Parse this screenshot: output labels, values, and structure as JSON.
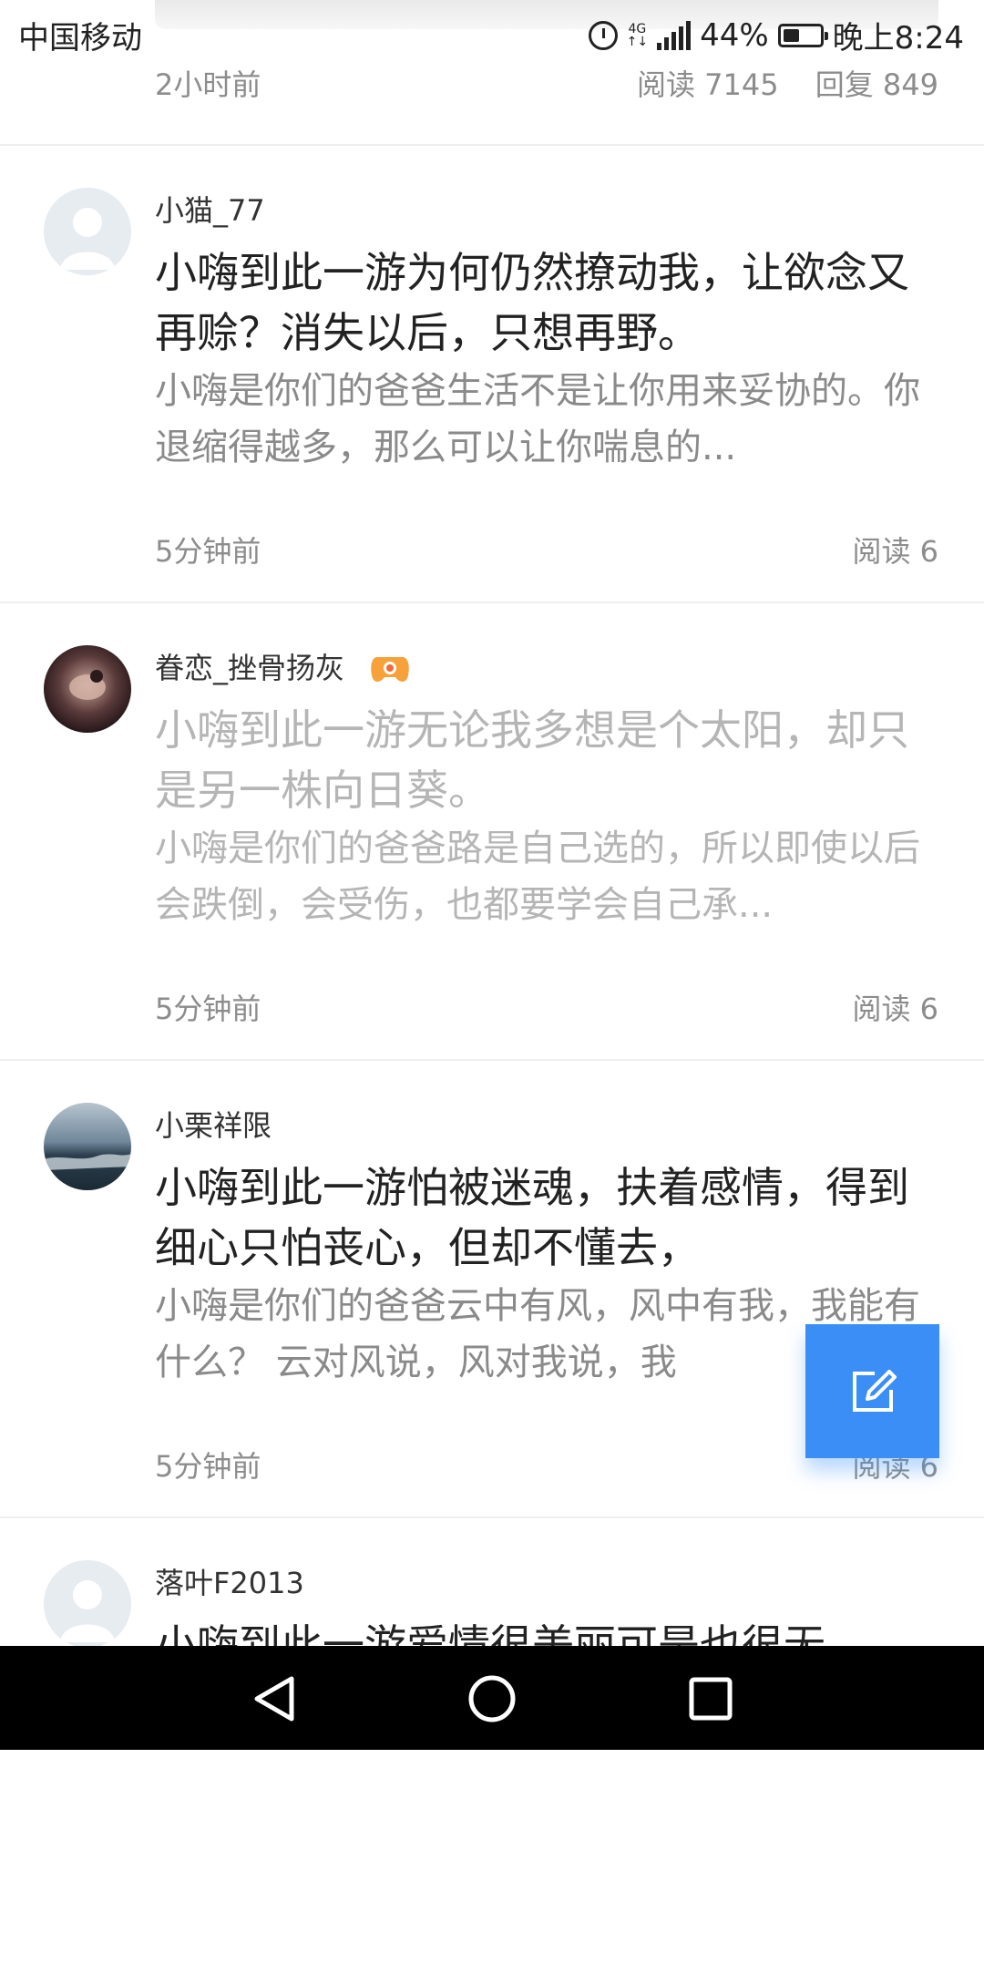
{
  "status_bar": {
    "carrier": "中国移动",
    "network": "4G",
    "battery": "44%",
    "time": "晚上8:24",
    "battery_level": 0.44
  },
  "previous_post_meta": {
    "time": "2小时前",
    "reads": "阅读 7145",
    "replies": "回复 849"
  },
  "posts": [
    {
      "username": "小猫_77",
      "title": "小嗨到此一游为何仍然撩动我，让欲念又再赊？消失以后，只想再野。",
      "summary": "小嗨是你们的爸爸生活不是让你用来妥协的。你退缩得越多，那么可以让你喘息的...",
      "time": "5分钟前",
      "reads": "阅读 6"
    },
    {
      "username": "眷恋_挫骨扬灰",
      "title": "小嗨到此一游无论我多想是个太阳，却只是另一株向日葵。",
      "summary": "小嗨是你们的爸爸路是自己选的，所以即使以后会跌倒，会受伤，也都要学会自己承...",
      "time": "5分钟前",
      "reads": "阅读 6"
    },
    {
      "username": "小栗祥限",
      "title": "小嗨到此一游怕被迷魂，扶着感情，得到细心只怕丧心，但却不懂去，",
      "summary": "小嗨是你们的爸爸云中有风，风中有我，我能有什么？ 云对风说，风对我说，我",
      "time": "5分钟前",
      "reads": "阅读 6"
    },
    {
      "username": "落叶F2013",
      "title": "小嗨到此一游爱情很美丽可是也很无"
    }
  ],
  "colors": {
    "accent": "#3a8ef6",
    "meta_text": "#8c8c8c",
    "faded_text": "#b5b5b5"
  },
  "icons": {
    "fab": "edit-icon",
    "nav": [
      "back-icon",
      "home-icon",
      "recents-icon"
    ]
  }
}
